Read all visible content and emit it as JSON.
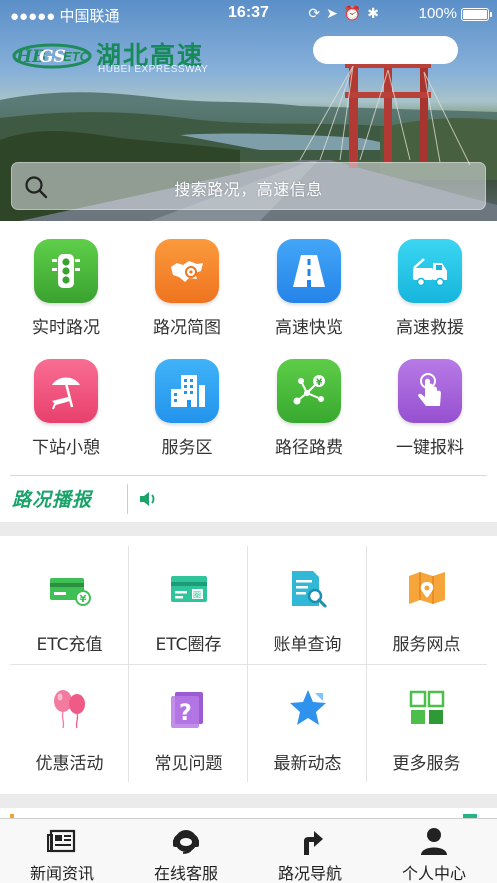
{
  "status_bar": {
    "carrier": "●●●●● 中国联通",
    "time": "16:37",
    "battery": "100%",
    "icons": [
      "orientation-lock-icon",
      "location-icon",
      "alarm-icon",
      "bluetooth-icon"
    ]
  },
  "brand": {
    "logo_mark": "HBGSETC",
    "name_cn": "湖北高速",
    "name_en": "HUBEI EXPRESSWAY"
  },
  "search": {
    "placeholder": "搜索路况，高速信息",
    "icon": "search-icon"
  },
  "quick_actions": [
    {
      "label": "实时路况",
      "icon": "traffic-light-icon",
      "color": "#45b83a"
    },
    {
      "label": "路况简图",
      "icon": "province-map-icon",
      "color": "#f5862a"
    },
    {
      "label": "高速快览",
      "icon": "road-icon",
      "color": "#2d8fef"
    },
    {
      "label": "高速救援",
      "icon": "tow-truck-icon",
      "color": "#26c6e8"
    },
    {
      "label": "下站小憩",
      "icon": "beach-umbrella-icon",
      "color": "#ef4f7d"
    },
    {
      "label": "服务区",
      "icon": "building-icon",
      "color": "#2f9ef2"
    },
    {
      "label": "路径路费",
      "icon": "route-fee-icon",
      "color": "#46bd43"
    },
    {
      "label": "一键报料",
      "icon": "tap-hand-icon",
      "color": "#a75fd8"
    }
  ],
  "ticker": {
    "title": "路况播报",
    "icon": "speaker-icon"
  },
  "services": [
    {
      "label": "ETC充值",
      "icon": "etc-card-yen-icon"
    },
    {
      "label": "ETC圈存",
      "icon": "etc-card-circle-icon"
    },
    {
      "label": "账单查询",
      "icon": "bill-search-icon"
    },
    {
      "label": "服务网点",
      "icon": "map-pin-icon"
    },
    {
      "label": "优惠活动",
      "icon": "balloons-icon"
    },
    {
      "label": "常见问题",
      "icon": "question-book-icon"
    },
    {
      "label": "最新动态",
      "icon": "star-icon"
    },
    {
      "label": "更多服务",
      "icon": "grid-more-icon"
    }
  ],
  "tabbar": [
    {
      "label": "新闻资讯",
      "icon": "newspaper-icon"
    },
    {
      "label": "在线客服",
      "icon": "headset-icon"
    },
    {
      "label": "路况导航",
      "icon": "turn-arrow-icon"
    },
    {
      "label": "个人中心",
      "icon": "person-icon"
    }
  ],
  "colors": {
    "brand_green": "#1aa36b",
    "service_green": "#25b583",
    "service_orange": "#f3a23a",
    "service_blue": "#2d8fef",
    "service_pink": "#ef4f7d",
    "service_purple": "#a75fd8"
  }
}
